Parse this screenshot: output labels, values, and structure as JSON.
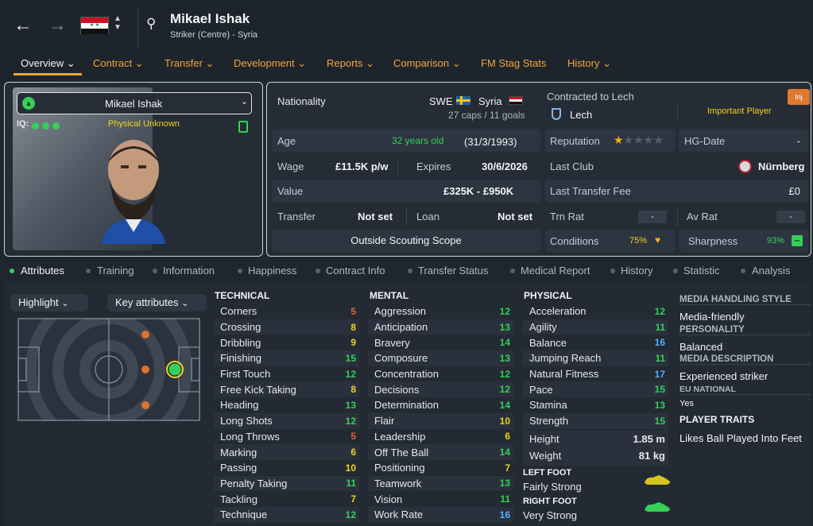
{
  "header": {
    "player_name": "Mikael Ishak",
    "subtitle": "Striker (Centre) - Syria"
  },
  "tabs": [
    {
      "label": "Overview"
    },
    {
      "label": "Contract"
    },
    {
      "label": "Transfer"
    },
    {
      "label": "Development"
    },
    {
      "label": "Reports"
    },
    {
      "label": "Comparison"
    },
    {
      "label": "FM Stag Stats"
    },
    {
      "label": "History"
    }
  ],
  "card": {
    "name": "Mikael Ishak",
    "iq_label": "IQ:",
    "physical": "Physical Unknown"
  },
  "info": {
    "nationality_label": "Nationality",
    "nat1": "SWE",
    "nat2": "Syria",
    "caps": "27 caps / 11 goals",
    "contracted_label": "Contracted to Lech",
    "club": "Lech",
    "inj": "Inj",
    "important": "Important Player",
    "age_label": "Age",
    "age": "32 years old",
    "dob": "(31/3/1993)",
    "reputation_label": "Reputation",
    "reputation_stars": 1,
    "hg_label": "HG-Date",
    "hg_value": "-",
    "wage_label": "Wage",
    "wage": "£11.5K p/w",
    "expires_label": "Expires",
    "expires": "30/6/2026",
    "last_club_label": "Last Club",
    "last_club": "Nürnberg",
    "value_label": "Value",
    "value": "£325K - £950K",
    "ltf_label": "Last Transfer Fee",
    "ltf": "£0",
    "transfer_label": "Transfer",
    "transfer": "Not set",
    "loan_label": "Loan",
    "loan": "Not set",
    "trn_label": "Trn Rat",
    "trn": "-",
    "av_label": "Av Rat",
    "av": "-",
    "scouting": "Outside Scouting Scope",
    "conditions_label": "Conditions",
    "conditions": "75%",
    "sharpness_label": "Sharpness",
    "sharpness": "93%"
  },
  "subtabs": [
    {
      "label": "Attributes"
    },
    {
      "label": "Training"
    },
    {
      "label": "Information"
    },
    {
      "label": "Happiness"
    },
    {
      "label": "Contract Info"
    },
    {
      "label": "Transfer Status"
    },
    {
      "label": "Medical Report"
    },
    {
      "label": "History"
    },
    {
      "label": "Statistic"
    },
    {
      "label": "Analysis"
    }
  ],
  "controls": {
    "highlight": "Highlight",
    "key_attributes": "Key attributes"
  },
  "technical": {
    "title": "TECHNICAL",
    "rows": [
      {
        "name": "Corners",
        "value": "5"
      },
      {
        "name": "Crossing",
        "value": "8"
      },
      {
        "name": "Dribbling",
        "value": "9"
      },
      {
        "name": "Finishing",
        "value": "15"
      },
      {
        "name": "First Touch",
        "value": "12"
      },
      {
        "name": "Free Kick Taking",
        "value": "8"
      },
      {
        "name": "Heading",
        "value": "13"
      },
      {
        "name": "Long Shots",
        "value": "12"
      },
      {
        "name": "Long Throws",
        "value": "5"
      },
      {
        "name": "Marking",
        "value": "6"
      },
      {
        "name": "Passing",
        "value": "10"
      },
      {
        "name": "Penalty Taking",
        "value": "11"
      },
      {
        "name": "Tackling",
        "value": "7"
      },
      {
        "name": "Technique",
        "value": "12"
      }
    ]
  },
  "mental": {
    "title": "MENTAL",
    "rows": [
      {
        "name": "Aggression",
        "value": "12"
      },
      {
        "name": "Anticipation",
        "value": "13"
      },
      {
        "name": "Bravery",
        "value": "14"
      },
      {
        "name": "Composure",
        "value": "13"
      },
      {
        "name": "Concentration",
        "value": "12"
      },
      {
        "name": "Decisions",
        "value": "12"
      },
      {
        "name": "Determination",
        "value": "14"
      },
      {
        "name": "Flair",
        "value": "10"
      },
      {
        "name": "Leadership",
        "value": "6"
      },
      {
        "name": "Off The Ball",
        "value": "14"
      },
      {
        "name": "Positioning",
        "value": "7"
      },
      {
        "name": "Teamwork",
        "value": "13"
      },
      {
        "name": "Vision",
        "value": "11"
      },
      {
        "name": "Work Rate",
        "value": "16"
      }
    ]
  },
  "physical": {
    "title": "PHYSICAL",
    "rows": [
      {
        "name": "Acceleration",
        "value": "12"
      },
      {
        "name": "Agility",
        "value": "11"
      },
      {
        "name": "Balance",
        "value": "16"
      },
      {
        "name": "Jumping Reach",
        "value": "11"
      },
      {
        "name": "Natural Fitness",
        "value": "17"
      },
      {
        "name": "Pace",
        "value": "15"
      },
      {
        "name": "Stamina",
        "value": "13"
      },
      {
        "name": "Strength",
        "value": "15"
      }
    ],
    "height_label": "Height",
    "height": "1.85 m",
    "weight_label": "Weight",
    "weight": "81 kg",
    "left_foot_label": "LEFT FOOT",
    "left_foot": "Fairly Strong",
    "right_foot_label": "RIGHT FOOT",
    "right_foot": "Very Strong"
  },
  "media": {
    "style_label": "MEDIA HANDLING STYLE",
    "style": "Media-friendly",
    "personality_label": "PERSONALITY",
    "personality": "Balanced",
    "desc_label": "MEDIA DESCRIPTION",
    "desc": "Experienced striker",
    "eu_label": "EU NATIONAL",
    "eu": "Yes",
    "traits_label": "PLAYER TRAITS",
    "traits": "Likes Ball Played Into Feet"
  }
}
